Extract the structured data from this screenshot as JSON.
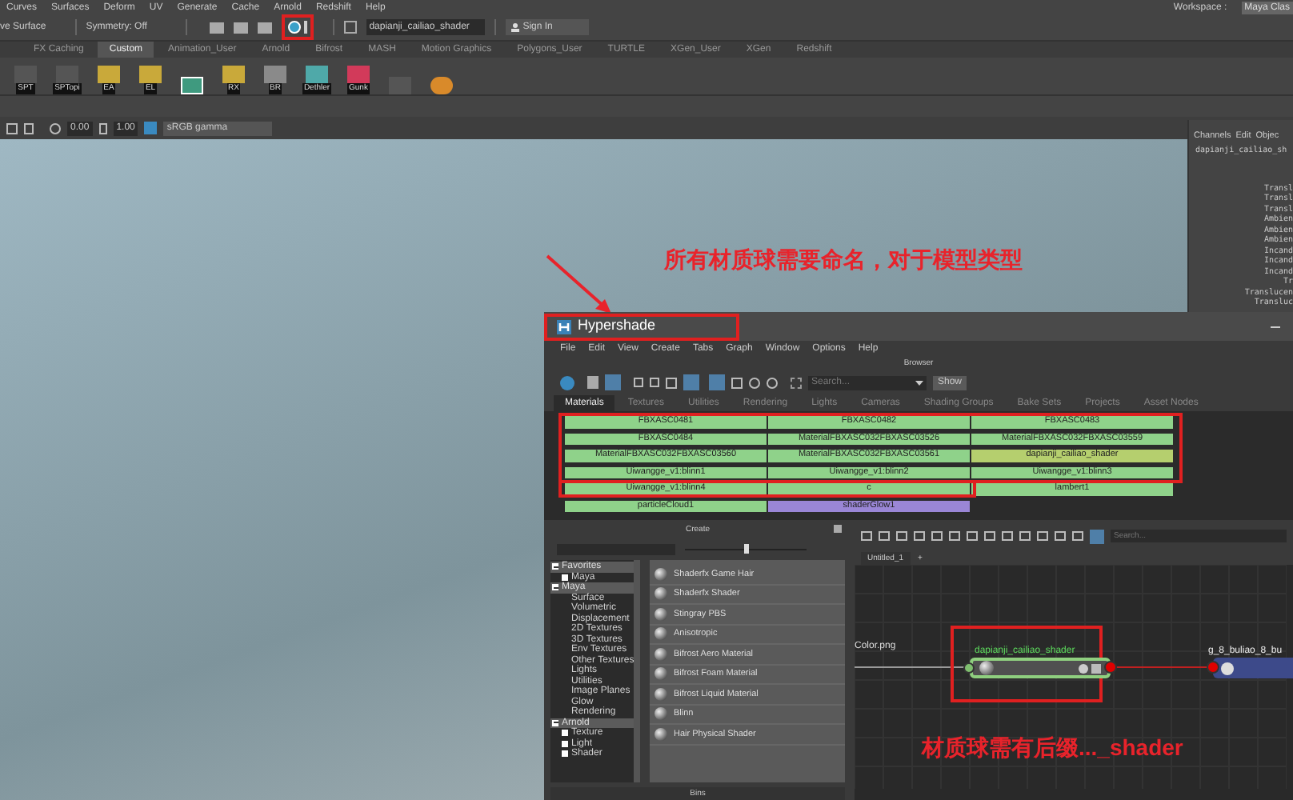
{
  "menu_bar": {
    "items": [
      "Curves",
      "Surfaces",
      "Deform",
      "UV",
      "Generate",
      "Cache",
      "Arnold",
      "Redshift",
      "Help"
    ],
    "workspace_label": "Workspace :",
    "workspace_value": "Maya Clas"
  },
  "status_line": {
    "mode": "ve Surface",
    "symmetry": "Symmetry: Off",
    "hypershade_button_highlighted": true,
    "object_name": "dapianji_cailiao_shader",
    "sign_in": "Sign In"
  },
  "shelf_tabs": [
    {
      "label": "FX Caching",
      "selected": false
    },
    {
      "label": "Custom",
      "selected": true
    },
    {
      "label": "Animation_User",
      "selected": false
    },
    {
      "label": "Arnold",
      "selected": false
    },
    {
      "label": "Bifrost",
      "selected": false
    },
    {
      "label": "MASH",
      "selected": false
    },
    {
      "label": "Motion Graphics",
      "selected": false
    },
    {
      "label": "Polygons_User",
      "selected": false
    },
    {
      "label": "TURTLE",
      "selected": false
    },
    {
      "label": "XGen_User",
      "selected": false
    },
    {
      "label": "XGen",
      "selected": false
    },
    {
      "label": "Redshift",
      "selected": false
    }
  ],
  "shelf_buttons": [
    {
      "kind": "letter",
      "label": "SPT"
    },
    {
      "kind": "letter",
      "label": "SPTopi"
    },
    {
      "kind": "folder",
      "label": "EA"
    },
    {
      "kind": "folder",
      "label": "EL"
    },
    {
      "kind": "grid"
    },
    {
      "kind": "folder",
      "label": "RX"
    },
    {
      "kind": "gray",
      "label": "BR"
    },
    {
      "kind": "teal",
      "label": "Dethler"
    },
    {
      "kind": "pink",
      "label": "Gunk"
    },
    {
      "kind": "letter"
    },
    {
      "kind": "orange"
    }
  ],
  "viewport_toolbar": {
    "exposure": "0.00",
    "gamma": "1.00",
    "color_space": "sRGB gamma"
  },
  "annotation_top": "所有材质球需要命名，对于模型类型",
  "channel_box": {
    "tabs": [
      "Channels",
      "Edit",
      "Objec"
    ],
    "object": "dapianji_cailiao_sh",
    "attributes": [
      "Transl",
      "Transl",
      "Transl",
      "Ambien",
      "Ambien",
      "Ambien",
      "Incand",
      "Incand",
      "Incand",
      "Tr",
      "Translucen",
      "Transluc"
    ]
  },
  "hypershade": {
    "title": "Hypershade",
    "title_highlighted": true,
    "menu": [
      "File",
      "Edit",
      "View",
      "Create",
      "Tabs",
      "Graph",
      "Window",
      "Options",
      "Help"
    ],
    "browser_label": "Browser",
    "search_placeholder": "Search...",
    "show_button": "Show",
    "tabs": [
      {
        "label": "Materials",
        "selected": true
      },
      {
        "label": "Textures",
        "selected": false
      },
      {
        "label": "Utilities",
        "selected": false
      },
      {
        "label": "Rendering",
        "selected": false
      },
      {
        "label": "Lights",
        "selected": false
      },
      {
        "label": "Cameras",
        "selected": false
      },
      {
        "label": "Shading Groups",
        "selected": false
      },
      {
        "label": "Bake Sets",
        "selected": false
      },
      {
        "label": "Projects",
        "selected": false
      },
      {
        "label": "Asset Nodes",
        "selected": false
      }
    ],
    "materials": [
      {
        "name": "FBXASC0481",
        "color": "#8fd28a"
      },
      {
        "name": "FBXASC0482",
        "color": "#8fd28a"
      },
      {
        "name": "FBXASC0483",
        "color": "#8fd28a"
      },
      {
        "name": "FBXASC0484",
        "color": "#8fd28a"
      },
      {
        "name": "MaterialFBXASC032FBXASC03526",
        "color": "#8fd28a"
      },
      {
        "name": "MaterialFBXASC032FBXASC03559",
        "color": "#8fd28a"
      },
      {
        "name": "MaterialFBXASC032FBXASC03560",
        "color": "#8fd28a"
      },
      {
        "name": "MaterialFBXASC032FBXASC03561",
        "color": "#8fd28a"
      },
      {
        "name": "dapianji_cailiao_shader",
        "color": "#b5cf6e"
      },
      {
        "name": "Uiwangge_v1:blinn1",
        "color": "#8fd28a"
      },
      {
        "name": "Uiwangge_v1:blinn2",
        "color": "#8fd28a"
      },
      {
        "name": "Uiwangge_v1:blinn3",
        "color": "#8fd28a"
      },
      {
        "name": "Uiwangge_v1:blinn4",
        "color": "#8fd28a"
      },
      {
        "name": "c",
        "color": "#8fd28a"
      },
      {
        "name": "lambert1",
        "color": "#8fd28a"
      },
      {
        "name": "particleCloud1",
        "color": "#8fd28a"
      },
      {
        "name": "shaderGlow1",
        "color": "#9a86d6"
      }
    ],
    "create_panel": {
      "title": "Create",
      "icon_size_slider": {
        "level": 0.5
      },
      "tree": [
        {
          "label": "Favorites",
          "expanded": true,
          "children": [
            {
              "label": "Maya",
              "expanded": false
            }
          ]
        },
        {
          "label": "Maya",
          "expanded": true,
          "children": [
            {
              "label": "Surface"
            },
            {
              "label": "Volumetric"
            },
            {
              "label": "Displacement"
            },
            {
              "label": "2D Textures"
            },
            {
              "label": "3D Textures"
            },
            {
              "label": "Env Textures"
            },
            {
              "label": "Other Textures"
            },
            {
              "label": "Lights"
            },
            {
              "label": "Utilities"
            },
            {
              "label": "Image Planes"
            },
            {
              "label": "Glow"
            },
            {
              "label": "Rendering"
            }
          ]
        },
        {
          "label": "Arnold",
          "expanded": true,
          "children": [
            {
              "label": "Texture",
              "expanded": false
            },
            {
              "label": "Light",
              "expanded": false
            },
            {
              "label": "Shader",
              "expanded": false
            }
          ]
        }
      ],
      "nodes": [
        "Shaderfx Game Hair",
        "Shaderfx Shader",
        "Stingray PBS",
        "Anisotropic",
        "Bifrost Aero Material",
        "Bifrost Foam Material",
        "Bifrost Liquid Material",
        "Blinn",
        "Hair Physical Shader"
      ]
    },
    "bins_label": "Bins",
    "node_editor": {
      "search_placeholder": "Search...",
      "tab": "Untitled_1",
      "add_tab": "+",
      "input_label": "Color.png",
      "shader_node": {
        "name": "dapianji_cailiao_shader",
        "highlighted": true
      },
      "target_node": {
        "name": "g_8_buliao_8_bu"
      },
      "annotation": "材质球需有后缀..._shader"
    }
  }
}
